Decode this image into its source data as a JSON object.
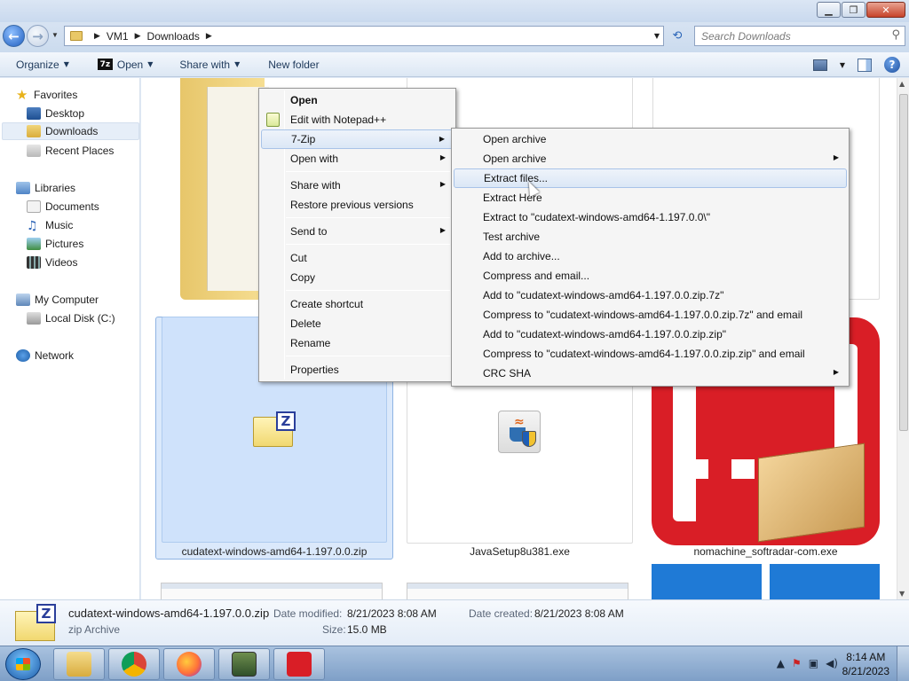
{
  "window": {
    "minimize": "▁",
    "maximize": "❐",
    "close": "✕"
  },
  "address": {
    "crumbs": [
      "VM1",
      "Downloads"
    ],
    "search_placeholder": "Search Downloads"
  },
  "toolbar": {
    "organize": "Organize",
    "open": "Open",
    "open_icon_text": "7z",
    "share_with": "Share with",
    "new_folder": "New folder"
  },
  "nav": {
    "favorites": "Favorites",
    "desktop": "Desktop",
    "downloads": "Downloads",
    "recent_places": "Recent Places",
    "libraries": "Libraries",
    "documents": "Documents",
    "music": "Music",
    "pictures": "Pictures",
    "videos": "Videos",
    "my_computer": "My Computer",
    "local_disk": "Local Disk (C:)",
    "network": "Network"
  },
  "files": {
    "zip_name": "cudatext-windows-amd64-1.197.0.0.zip",
    "java_name": "JavaSetup8u381.exe",
    "nomachine_name": "nomachine_softradar-com.exe"
  },
  "context_menu": {
    "open": "Open",
    "edit_notepad": "Edit with Notepad++",
    "seven_zip": "7-Zip",
    "open_with": "Open with",
    "share_with": "Share with",
    "restore": "Restore previous versions",
    "send_to": "Send to",
    "cut": "Cut",
    "copy": "Copy",
    "create_shortcut": "Create shortcut",
    "delete": "Delete",
    "rename": "Rename",
    "properties": "Properties"
  },
  "submenu": {
    "items": [
      "Open archive",
      "Open archive",
      "Extract files...",
      "Extract Here",
      "Extract to \"cudatext-windows-amd64-1.197.0.0\\\"",
      "Test archive",
      "Add to archive...",
      "Compress and email...",
      "Add to \"cudatext-windows-amd64-1.197.0.0.zip.7z\"",
      "Compress to \"cudatext-windows-amd64-1.197.0.0.zip.7z\" and email",
      "Add to \"cudatext-windows-amd64-1.197.0.0.zip.zip\"",
      "Compress to \"cudatext-windows-amd64-1.197.0.0.zip.zip\" and email",
      "CRC SHA"
    ]
  },
  "details": {
    "name": "cudatext-windows-amd64-1.197.0.0.zip",
    "type": "zip Archive",
    "modified_label": "Date modified:",
    "modified_value": "8/21/2023 8:08 AM",
    "size_label": "Size:",
    "size_value": "15.0 MB",
    "created_label": "Date created:",
    "created_value": "8/21/2023 8:08 AM"
  },
  "taskbar": {
    "time": "8:14 AM",
    "date": "8/21/2023"
  }
}
